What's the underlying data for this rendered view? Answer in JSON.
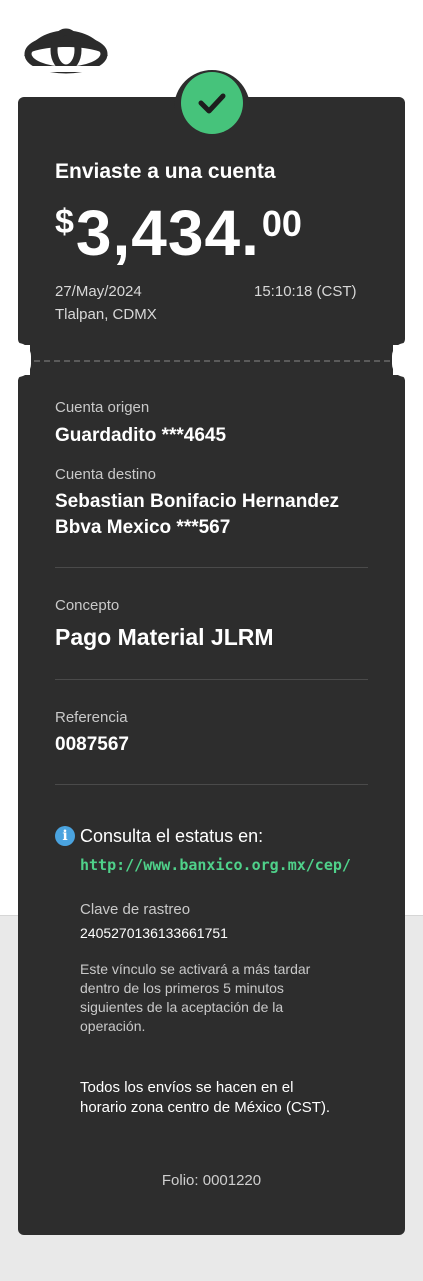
{
  "app": {
    "logo_icon": "bank-eye-logo",
    "status_icon": "check-icon",
    "accent_color": "#46c37b",
    "link_color": "#4fd18a",
    "info_color": "#4aa3df"
  },
  "receipt": {
    "title": "Enviaste a una cuenta",
    "amount_currency": "$",
    "amount_int": "3,434.",
    "amount_dec": "00",
    "date": "27/May/2024",
    "time": "15:10:18 (CST)",
    "location": "Tlalpan, CDMX"
  },
  "details": {
    "origin_label": "Cuenta origen",
    "origin_value": "Guardadito ***4645",
    "dest_label": "Cuenta destino",
    "dest_name": "Sebastian Bonifacio Hernandez",
    "dest_bank": "Bbva Mexico ***567",
    "concept_label": "Concepto",
    "concept_value": "Pago Material JLRM",
    "reference_label": "Referencia",
    "reference_value": "0087567"
  },
  "status": {
    "consulta_text": "Consulta el estatus en:",
    "url": "http://www.banxico.org.mx/cep/",
    "tracking_label": "Clave de rastreo",
    "tracking_value": "2405270136133661751",
    "note_lines": [
      "Este vínculo se activará a más tardar",
      "dentro de los primeros 5 minutos",
      "siguientes de la aceptación de la",
      "operación."
    ],
    "timezone_lines": [
      "Todos los envíos se hacen en el",
      "horario zona centro de México (CST)."
    ]
  },
  "folio": "Folio: 0001220"
}
